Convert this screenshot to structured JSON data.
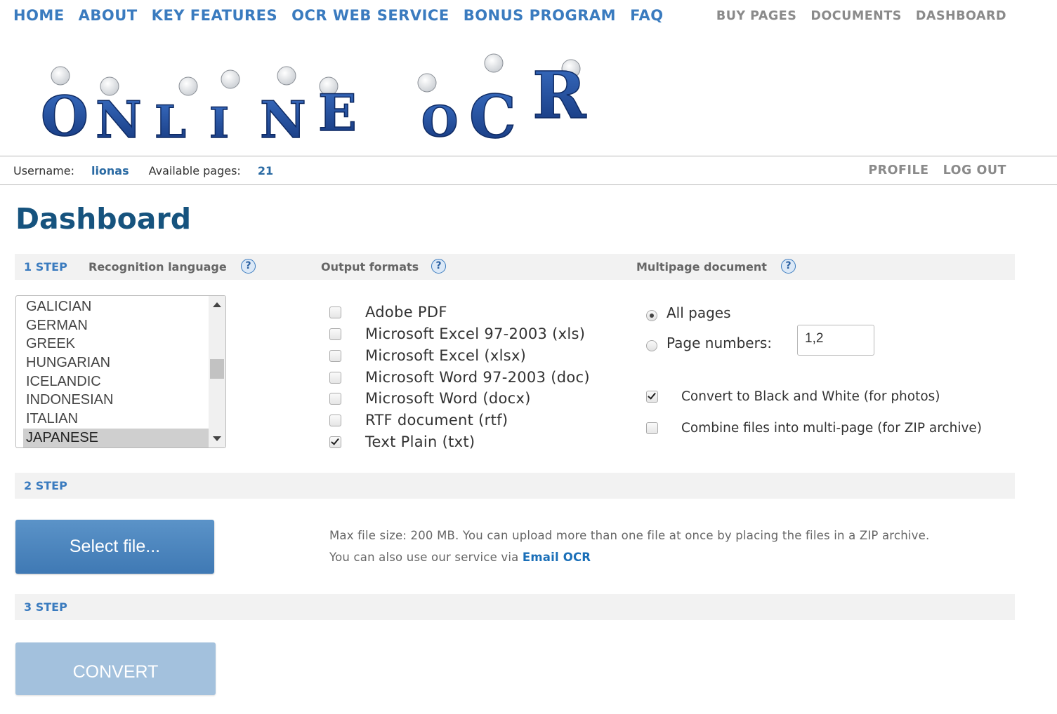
{
  "nav": {
    "main": [
      "HOME",
      "ABOUT",
      "KEY FEATURES",
      "OCR WEB SERVICE",
      "BONUS PROGRAM",
      "FAQ"
    ],
    "right": [
      "BUY PAGES",
      "DOCUMENTS",
      "DASHBOARD"
    ]
  },
  "logo": {
    "letters": [
      "O",
      "N",
      "L",
      "I",
      "N",
      "E",
      "O",
      "C",
      "R"
    ]
  },
  "userbar": {
    "username_label": "Username:",
    "username": "lionas",
    "pages_label": "Available pages:",
    "pages": "21",
    "links": [
      "PROFILE",
      "LOG OUT"
    ]
  },
  "page_title": "Dashboard",
  "step1": {
    "step_label": "1 STEP",
    "language_label": "Recognition language",
    "formats_label": "Output formats",
    "multipage_label": "Multipage document",
    "help_glyph": "?",
    "languages": [
      "GALICIAN",
      "GERMAN",
      "GREEK",
      "HUNGARIAN",
      "ICELANDIC",
      "INDONESIAN",
      "ITALIAN",
      "JAPANESE"
    ],
    "selected_language": "JAPANESE",
    "formats": [
      {
        "label": "Adobe PDF",
        "checked": false
      },
      {
        "label": "Microsoft Excel 97-2003 (xls)",
        "checked": false
      },
      {
        "label": "Microsoft Excel (xlsx)",
        "checked": false
      },
      {
        "label": "Microsoft Word 97-2003 (doc)",
        "checked": false
      },
      {
        "label": "Microsoft Word (docx)",
        "checked": false
      },
      {
        "label": "RTF document (rtf)",
        "checked": false
      },
      {
        "label": "Text Plain (txt)",
        "checked": true
      }
    ],
    "all_pages_label": "All pages",
    "page_numbers_label": "Page numbers:",
    "page_numbers_value": "1,2",
    "bw_label": "Convert to Black and White (for photos)",
    "bw_checked": true,
    "combine_label": "Combine files into multi-page (for ZIP archive)",
    "combine_checked": false
  },
  "step2": {
    "step_label": "2 STEP",
    "select_button": "Select file...",
    "info_line1": "Max file size: 200 MB. You can upload more than one file at once by placing the files in a ZIP archive.",
    "info_line2_prefix": "You can also use our service via",
    "info_link": "Email OCR"
  },
  "step3": {
    "step_label": "3 STEP",
    "convert_button": "CONVERT"
  },
  "colors": {
    "nav_blue": "#3a7bbf",
    "title_blue": "#16537e",
    "gray_link": "#8a8a8a",
    "button_blue": "#4a86bf",
    "button_disabled": "#a3c1dd"
  }
}
